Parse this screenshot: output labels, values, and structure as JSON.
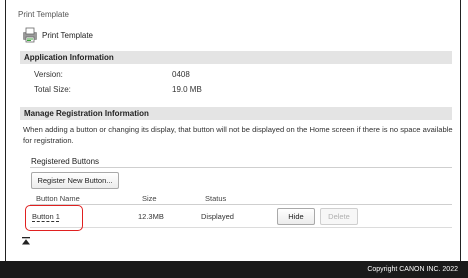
{
  "page_title": "Print Template",
  "app": {
    "name": "Print Template",
    "icon": "print-template-icon"
  },
  "sections": {
    "application_information": {
      "title": "Application Information",
      "version_label": "Version:",
      "version_value": "0408",
      "total_size_label": "Total Size:",
      "total_size_value": "19.0 MB"
    },
    "manage_registration": {
      "title": "Manage Registration Information",
      "description": "When adding a button or changing its display, that button will not be displayed on the Home screen if there is no space available for registration."
    }
  },
  "registered_buttons": {
    "title": "Registered Buttons",
    "register_button_label": "Register New Button...",
    "columns": [
      "Button Name",
      "Size",
      "Status"
    ],
    "rows": [
      {
        "name": "Button 1",
        "size": "12.3MB",
        "status": "Displayed",
        "hide_label": "Hide",
        "delete_label": "Delete"
      }
    ]
  },
  "scroll_top_icon": "scroll-to-top-icon",
  "footer": {
    "copyright": "Copyright CANON INC. 2022"
  },
  "colors": {
    "highlight": "#e02020",
    "footer_bg": "#1a1a1a",
    "section_header_bg": "#e4e4e4"
  }
}
